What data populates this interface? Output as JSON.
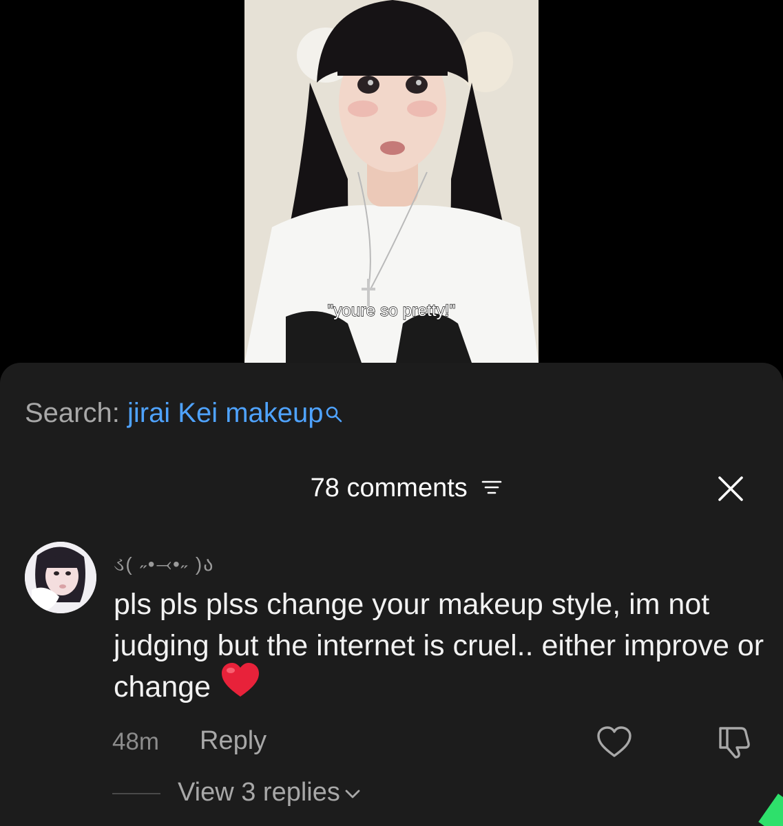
{
  "video": {
    "caption": "\"youre so pretty!\""
  },
  "search": {
    "prefix": "Search: ",
    "query": "jirai Kei makeup"
  },
  "comments_sheet": {
    "title": "78 comments"
  },
  "comment": {
    "username": "ડ( ˶•⤙•˶ )ა",
    "text": "pls pls plss change your makeup style, im not judging but the internet is cruel.. either improve or change",
    "time": "48m",
    "reply_label": "Reply",
    "view_replies_label": "View 3 replies"
  },
  "colors": {
    "sheet_bg": "#1c1c1c",
    "link_blue": "#4fa3ff",
    "muted_text": "#a8a8a8",
    "emoji_heart": "#e8223a"
  },
  "icons": [
    "search-icon",
    "sort-icon",
    "close-icon",
    "heart-icon",
    "dislike-icon",
    "chevron-down-icon",
    "red-heart-emoji"
  ]
}
